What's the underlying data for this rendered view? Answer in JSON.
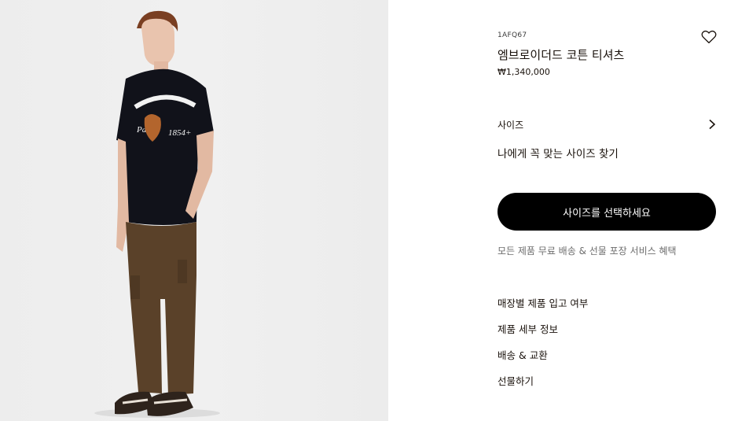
{
  "product": {
    "sku": "1AFQ67",
    "name": "엠브로이더드 코튼 티셔츠",
    "price": "₩1,340,000"
  },
  "size": {
    "label": "사이즈",
    "fit_finder": "나에게 꼭 맞는 사이즈 찾기",
    "cta": "사이즈를 선택하세요"
  },
  "benefit": "모든 제품 무료 배송 & 선물 포장 서비스 혜택",
  "links": [
    "매장별 제품 입고 여부",
    "제품 세부 정보",
    "배송 & 교환",
    "선물하기"
  ],
  "icons": {
    "wishlist": "heart-icon",
    "size_chevron": "chevron-right-icon"
  },
  "colors": {
    "cta_background": "#000000",
    "cta_text": "#ffffff",
    "text": "#19110b",
    "muted_text": "#6d6d6d"
  }
}
